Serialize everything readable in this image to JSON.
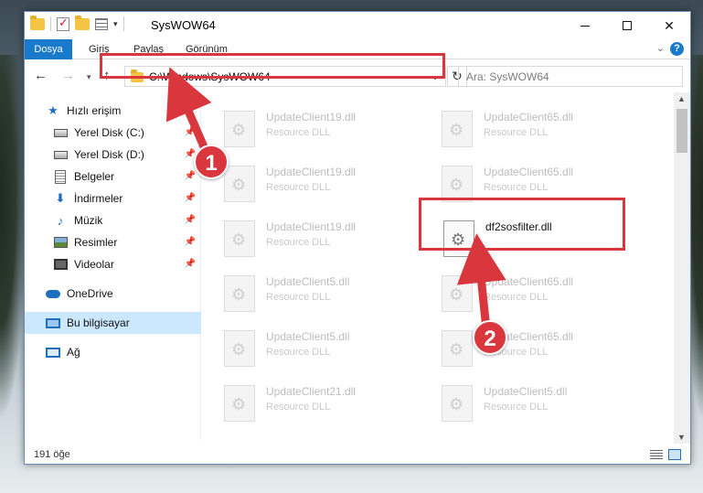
{
  "window": {
    "title": "SysWOW64",
    "ribbon_tabs": [
      "Dosya",
      "Giriş",
      "Paylaş",
      "Görünüm"
    ],
    "controls": {
      "minimize": "—",
      "maximize": "☐",
      "close": "✕"
    }
  },
  "address_bar": {
    "path": "C:\\Windows\\SysWOW64",
    "refresh_icon": "↻"
  },
  "search": {
    "placeholder": "Ara: SysWOW64"
  },
  "nav_pane": {
    "quick_access": "Hızlı erişim",
    "items": [
      {
        "label": "Yerel Disk (C:)",
        "icon": "drive-icon"
      },
      {
        "label": "Yerel Disk (D:)",
        "icon": "drive-icon"
      },
      {
        "label": "Belgeler",
        "icon": "documents-icon"
      },
      {
        "label": "İndirmeler",
        "icon": "downloads-icon"
      },
      {
        "label": "Müzik",
        "icon": "music-icon"
      },
      {
        "label": "Resimler",
        "icon": "pictures-icon"
      },
      {
        "label": "Videolar",
        "icon": "videos-icon"
      }
    ],
    "onedrive": "OneDrive",
    "this_pc": "Bu bilgisayar",
    "network": "Ağ"
  },
  "files": [
    {
      "name": "UpdateClient19.dll",
      "type": "Resource DLL"
    },
    {
      "name": "UpdateClient65.dll",
      "type": "Resource DLL"
    },
    {
      "name": "UpdateClient19.dll",
      "type": "Resource DLL"
    },
    {
      "name": "UpdateClient65.dll",
      "type": "Resource DLL"
    },
    {
      "name": "UpdateClient19.dll",
      "type": "Resource DLL"
    },
    {
      "name": "df2sosfilter.dll",
      "type": ""
    },
    {
      "name": "UpdateClient5.dll",
      "type": "Resource DLL"
    },
    {
      "name": "UpdateClient65.dll",
      "type": "Resource DLL"
    },
    {
      "name": "UpdateClient5.dll",
      "type": "Resource DLL"
    },
    {
      "name": "UpdateClient65.dll",
      "type": "Resource DLL"
    },
    {
      "name": "UpdateClient21.dll",
      "type": "Resource DLL"
    },
    {
      "name": "UpdateClient5.dll",
      "type": "Resource DLL"
    }
  ],
  "status": {
    "item_count": "191 öğe"
  },
  "annotations": {
    "step1": "1",
    "step2": "2",
    "highlight_color": "#d9363e"
  }
}
